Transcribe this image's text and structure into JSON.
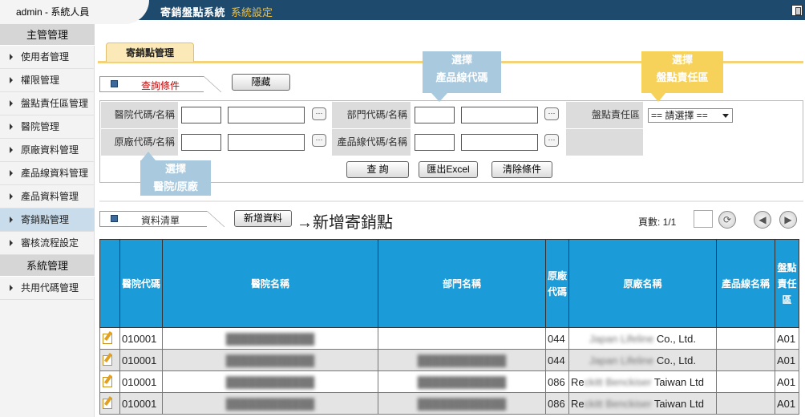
{
  "header": {
    "user": "admin - 系統人員",
    "app_title": "寄銷盤點系統",
    "app_subtitle": "系統設定"
  },
  "sidebar": {
    "group1": "主管管理",
    "items1": [
      "使用者管理",
      "權限管理",
      "盤點責任區管理",
      "醫院管理",
      "原廠資料管理",
      "產品線資料管理",
      "產品資料管理",
      "寄銷點管理",
      "審核流程設定"
    ],
    "group2": "系統管理",
    "items2": [
      "共用代碼管理"
    ],
    "active": "寄銷點管理"
  },
  "page_tab": "寄銷點管理",
  "query": {
    "section_label": "查詢條件",
    "hide_button": "隱藏",
    "labels": {
      "hospital": "醫院代碼/名稱",
      "department": "部門代碼/名稱",
      "zone": "盤點責任區",
      "vendor": "原廠代碼/名稱",
      "product_line": "產品線代碼/名稱"
    },
    "zone_select": "== 請選擇 ==",
    "browse": "···",
    "buttons": {
      "search": "查 詢",
      "export": "匯出Excel",
      "clear": "清除條件"
    }
  },
  "callouts": {
    "product_line": [
      "選擇",
      "產品線代碼"
    ],
    "zone": [
      "選擇",
      "盤點責任區"
    ],
    "hospital": [
      "選擇",
      "醫院/原廠"
    ]
  },
  "list": {
    "section_label": "資料清單",
    "new_button": "新增資料",
    "annotation": "→新增寄銷點",
    "page_label": "頁數: 1/1",
    "prev": "◀",
    "next": "▶"
  },
  "table": {
    "columns": [
      "",
      "醫院代碼",
      "醫院名稱",
      "部門名稱",
      "原廠代碼",
      "原廠名稱",
      "產品線名稱",
      "盤點責任區"
    ],
    "rows": [
      {
        "hospital_code": "010001",
        "hospital_name": "████████████",
        "dept": "",
        "vendor_code": "044",
        "vendor_name_blur": "Japan Lifeline ",
        "vendor_name": "Co., Ltd.",
        "product_line": "",
        "zone": "A01"
      },
      {
        "hospital_code": "010001",
        "hospital_name": "████████████",
        "dept": "████████████",
        "vendor_code": "044",
        "vendor_name_blur": "Japan Lifeline ",
        "vendor_name": "Co., Ltd.",
        "product_line": "",
        "zone": "A01"
      },
      {
        "hospital_code": "010001",
        "hospital_name": "████████████",
        "dept": "████████████",
        "vendor_code": "086",
        "vendor_name_pre": "Re",
        "vendor_name_blur": "ckitt Benckiser ",
        "vendor_name": "Taiwan Ltd",
        "product_line": "",
        "zone": "A01"
      },
      {
        "hospital_code": "010001",
        "hospital_name": "████████████",
        "dept": "████████████",
        "vendor_code": "086",
        "vendor_name_pre": "Re",
        "vendor_name_blur": "ckitt Benckiser ",
        "vendor_name": "Taiwan Ltd",
        "product_line": "",
        "zone": "A01"
      }
    ]
  },
  "colors": {
    "topbar": "#1e4a6e",
    "subtitle": "#f0c040",
    "table_header": "#1b9cd8",
    "callout_blue": "#a9c9de",
    "callout_yellow": "#f6d25a",
    "query_label": "#cc0000"
  }
}
